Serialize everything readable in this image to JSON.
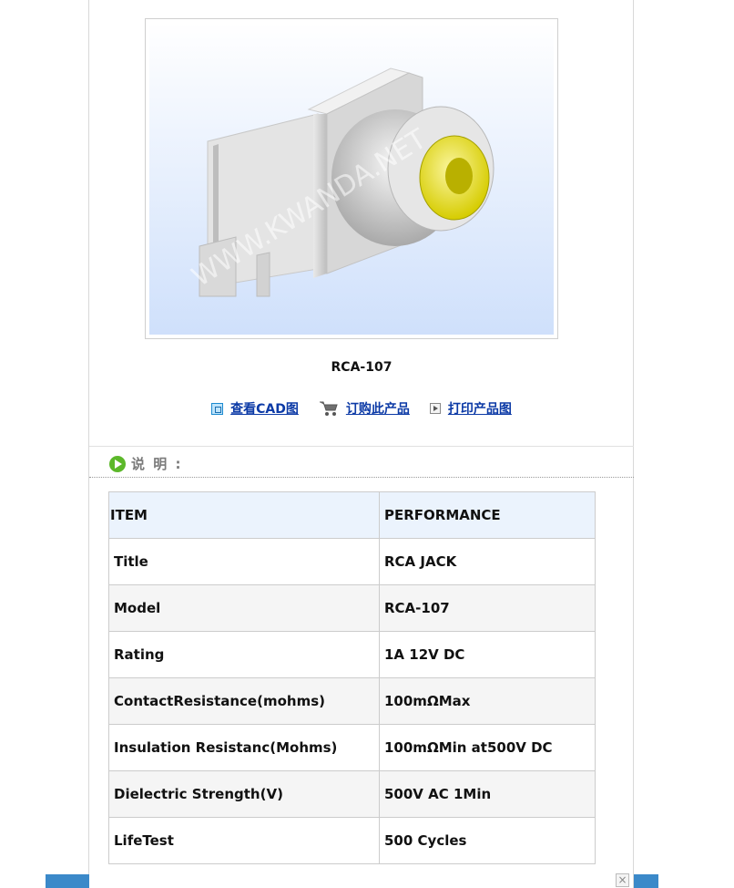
{
  "product": {
    "name": "RCA-107",
    "watermark": "WWW.KWANDA.NET"
  },
  "actions": [
    {
      "label": "查看CAD图",
      "icon": "cad-icon"
    },
    {
      "label": "订购此产品",
      "icon": "cart-icon"
    },
    {
      "label": "打印产品图",
      "icon": "print-icon"
    }
  ],
  "section": {
    "title": "说 明 :"
  },
  "specs": {
    "header": [
      "ITEM",
      "PERFORMANCE"
    ],
    "rows": [
      [
        "Title",
        "RCA JACK"
      ],
      [
        "Model",
        "RCA-107"
      ],
      [
        "Rating",
        "1A 12V DC"
      ],
      [
        "ContactResistance(mohms)",
        "100mΩMax"
      ],
      [
        "Insulation Resistanc(Mohms)",
        "100mΩMin at500V DC"
      ],
      [
        "Dielectric Strength(V)",
        "500V AC 1Min"
      ],
      [
        "LifeTest",
        "500 Cycles"
      ]
    ]
  },
  "colors": {
    "accent_blue": "#3b89c9",
    "link": "#0c3aa6",
    "connector_yellow": "#e8e000",
    "header_row": "#ebf3fd"
  },
  "close": {
    "symbol": "×"
  }
}
